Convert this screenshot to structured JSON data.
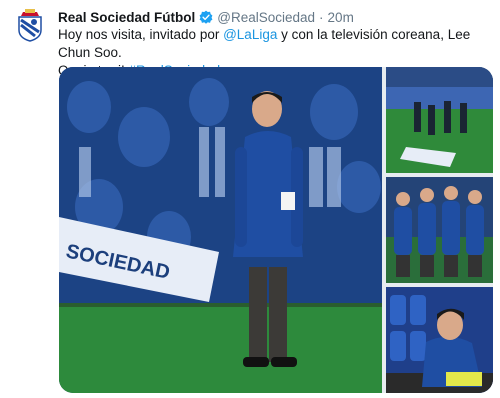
{
  "tweet": {
    "display_name": "Real Sociedad Fútbol",
    "handle": "@RealSociedad",
    "separator": "·",
    "timestamp": "20m",
    "text": {
      "part1": "Hoy nos visita, invitado por ",
      "mention": "@LaLiga",
      "part2": " y con la televisión coreana, Lee Chun Soo.",
      "line2": "Ongi etorri! ",
      "hashtag": "#RealSociedad"
    },
    "photo1_banner_text": "SOCIEDAD",
    "colors": {
      "link": "#1b95e0",
      "muted": "#657786",
      "verified": "#1da1f2",
      "club_blue": "#1f4ea3",
      "pitch_green": "#2d8a3c"
    },
    "icons": {
      "verified": "verified-badge-icon",
      "avatar": "club-crest-icon"
    }
  }
}
